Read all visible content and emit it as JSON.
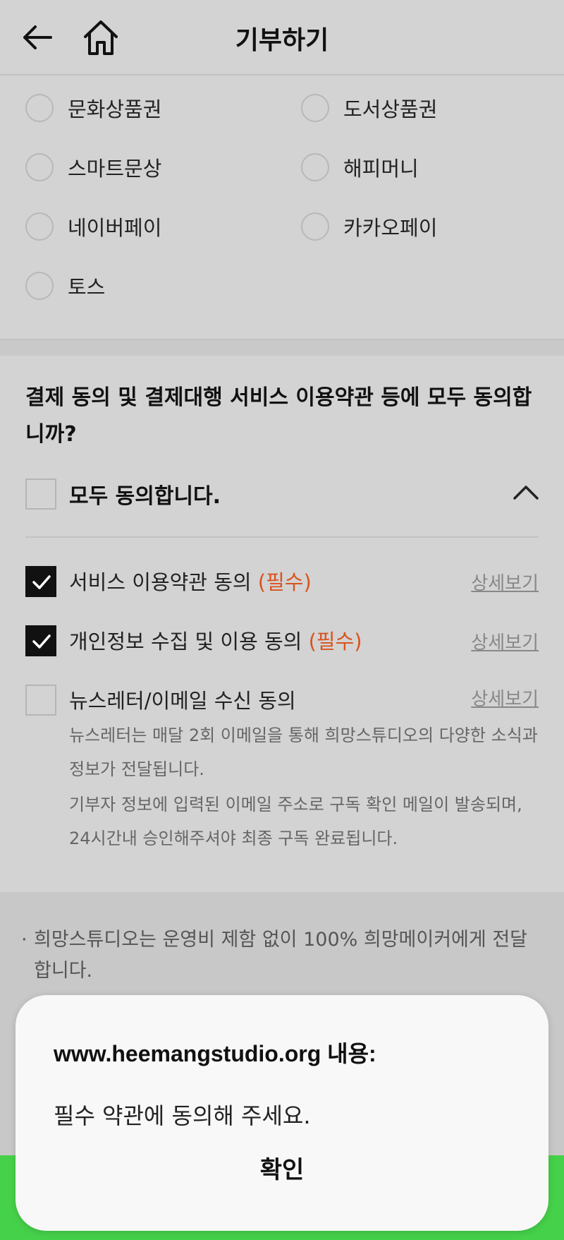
{
  "header": {
    "title": "기부하기"
  },
  "payments": {
    "options": [
      "문화상품권",
      "도서상품권",
      "스마트문상",
      "해피머니",
      "네이버페이",
      "카카오페이",
      "토스"
    ]
  },
  "terms": {
    "question": "결제 동의 및 결제대행 서비스 이용약관 등에 모두 동의합니까?",
    "agree_all": "모두 동의합니다.",
    "items": [
      {
        "label": "서비스 이용약관 동의",
        "required": "(필수)",
        "detail": "상세보기",
        "checked": true
      },
      {
        "label": "개인정보 수집 및 이용 동의",
        "required": "(필수)",
        "detail": "상세보기",
        "checked": true
      },
      {
        "label": "뉴스레터/이메일 수신 동의",
        "required": "",
        "detail": "상세보기",
        "checked": false
      }
    ],
    "newsletter_desc_1": "뉴스레터는 매달 2회 이메일을 통해 희망스튜디오의 다양한 소식과 정보가 전달됩니다.",
    "newsletter_desc_2": "기부자 정보에 입력된 이메일 주소로 구독 확인 메일이 발송되며, 24시간내 승인해주셔야 최종 구독 완료됩니다."
  },
  "notes": {
    "bullet": "·",
    "text": "희망스튜디오는 운영비 제함 없이 100% 희망메이커에게 전달합니다."
  },
  "dialog": {
    "title": "www.heemangstudio.org 내용:",
    "message": "필수 약관에 동의해 주세요.",
    "confirm": "확인"
  },
  "colors": {
    "required": "#d9531e",
    "accent_green": "#46d14a"
  }
}
